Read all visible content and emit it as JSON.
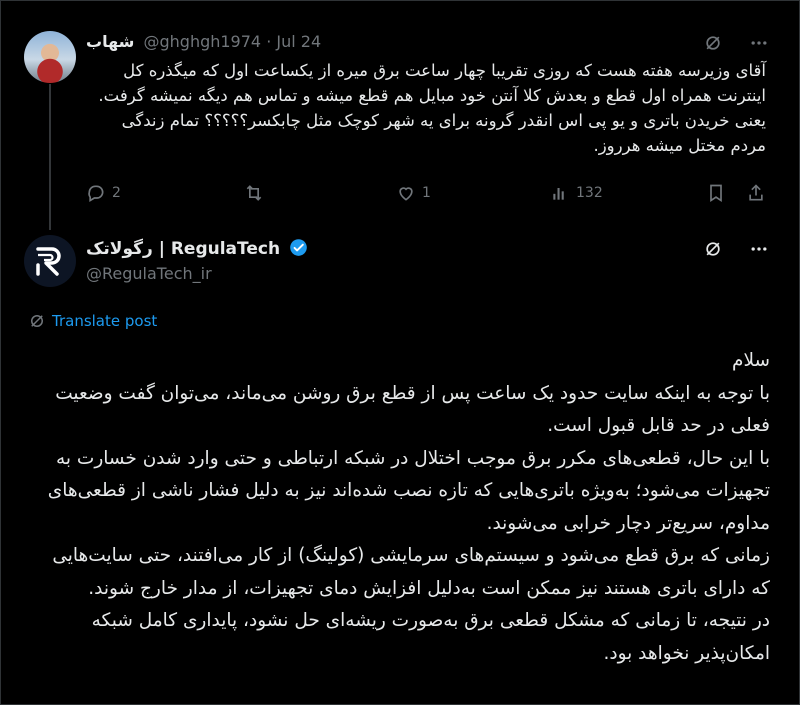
{
  "tweet1": {
    "author_name": "شهاب",
    "handle": "@ghghgh1974",
    "separator": "·",
    "date": "Jul 24",
    "body": "آقای وزیرسه هفته هست که روزی تقریبا چهار ساعت برق میره از یکساعت اول که میگذره کل اینترنت همراه اول قطع و بعدش کلا آنتن خود مبایل هم قطع میشه و تماس هم دیگه نمیشه گرفت. یعنی خریدن باتری و یو پی اس انقدر گرونه برای یه شهر کوچک مثل چابکسر؟؟؟؟؟ تمام زندگی مردم مختل میشه هرروز.",
    "actions": {
      "replies": "2",
      "reposts": "",
      "likes": "1",
      "views": "132"
    }
  },
  "tweet2": {
    "author_name": "رگولاتک | RegulaTech",
    "handle": "@RegulaTech_ir",
    "translate_label": "Translate post",
    "paragraphs": [
      "سلام",
      "با توجه به اینکه سایت حدود یک ساعت پس از قطع برق روشن می‌ماند، می‌توان گفت وضعیت فعلی در حد قابل قبول است.",
      "با این حال، قطعی‌های مکرر برق موجب اختلال در شبکه ارتباطی و حتی وارد شدن خسارت به تجهیزات می‌شود؛ به‌ویژه باتری‌هایی که تازه نصب شده‌اند نیز به دلیل فشار ناشی از قطعی‌های مداوم، سریع‌تر دچار خرابی می‌شوند.",
      "زمانی که برق قطع می‌شود و سیستم‌های سرمایشی (کولینگ) از کار می‌افتند، حتی سایت‌هایی که دارای باتری هستند نیز ممکن است به‌دلیل افزایش دمای تجهیزات، از مدار خارج شوند.",
      "در نتیجه، تا زمانی که مشکل قطعی برق به‌صورت ریشه‌ای حل نشود، پایداری کامل شبکه امکان‌پذیر نخواهد بود."
    ]
  },
  "colors": {
    "background": "#000000",
    "text": "#e7e9ea",
    "muted": "#71767b",
    "link": "#1d9bf0",
    "verified": "#1d9bf0"
  },
  "icons": {
    "grok": "grok-icon",
    "more": "more-icon",
    "reply": "reply-icon",
    "repost": "repost-icon",
    "like": "like-icon",
    "views": "views-icon",
    "bookmark": "bookmark-icon",
    "share": "share-icon",
    "translate": "translate-icon",
    "verified": "verified-badge-icon"
  }
}
